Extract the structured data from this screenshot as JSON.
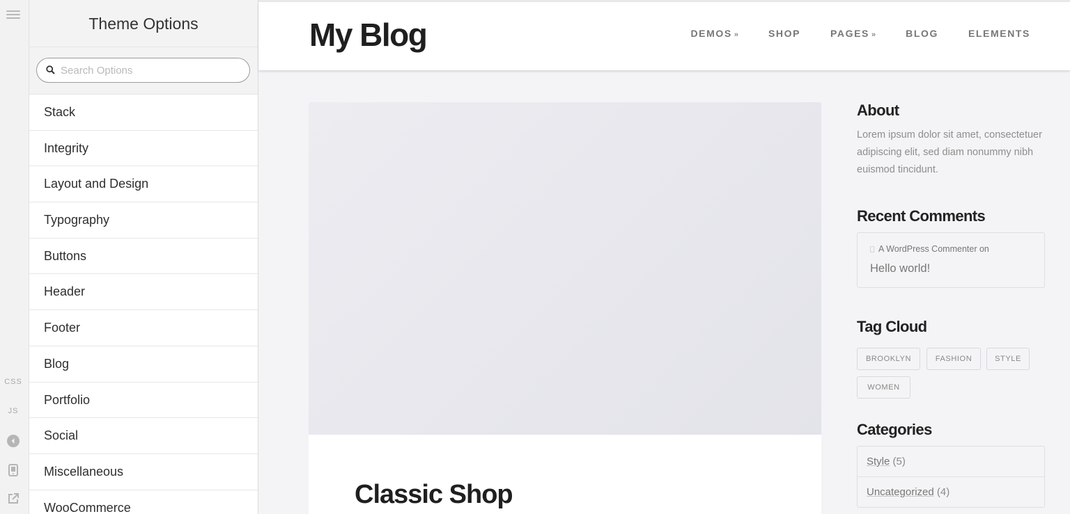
{
  "rail": {
    "css_label": "CSS",
    "js_label": "JS",
    "icons": [
      "hamburger-menu-icon",
      "collapse-left-icon",
      "mobile-device-icon",
      "external-link-icon"
    ]
  },
  "panel": {
    "title": "Theme Options",
    "search_placeholder": "Search Options",
    "items": [
      {
        "label": "Stack"
      },
      {
        "label": "Integrity"
      },
      {
        "label": "Layout and Design"
      },
      {
        "label": "Typography"
      },
      {
        "label": "Buttons"
      },
      {
        "label": "Header"
      },
      {
        "label": "Footer"
      },
      {
        "label": "Blog"
      },
      {
        "label": "Portfolio"
      },
      {
        "label": "Social"
      },
      {
        "label": "Miscellaneous"
      },
      {
        "label": "WooCommerce"
      }
    ]
  },
  "site": {
    "logo": "My Blog",
    "nav": [
      {
        "label": "DEMOS",
        "dropdown": true
      },
      {
        "label": "SHOP",
        "dropdown": false
      },
      {
        "label": "PAGES",
        "dropdown": true
      },
      {
        "label": "BLOG",
        "dropdown": false
      },
      {
        "label": "ELEMENTS",
        "dropdown": false
      }
    ],
    "post_title": "Classic Shop"
  },
  "sidebar": {
    "about_title": "About",
    "about_text": "Lorem ipsum dolor sit amet, consectetuer adipiscing elit, sed diam nonummy nibh euismod tincidunt.",
    "comments_title": "Recent Comments",
    "comment_author": "A WordPress Commenter on",
    "comment_post": "Hello world!",
    "tags_title": "Tag Cloud",
    "tags": [
      "BROOKLYN",
      "FASHION",
      "STYLE",
      "WOMEN"
    ],
    "categories_title": "Categories",
    "categories": [
      {
        "name": "Style",
        "count": "(5)"
      },
      {
        "name": "Uncategorized",
        "count": "(4)"
      }
    ]
  },
  "colors": {
    "panel_bg": "#ffffff",
    "panel_head_bg": "#f3f3f3",
    "site_bg": "#f4f4f6",
    "text_dark": "#1f1f1f",
    "text_muted": "#8e8e8e"
  }
}
